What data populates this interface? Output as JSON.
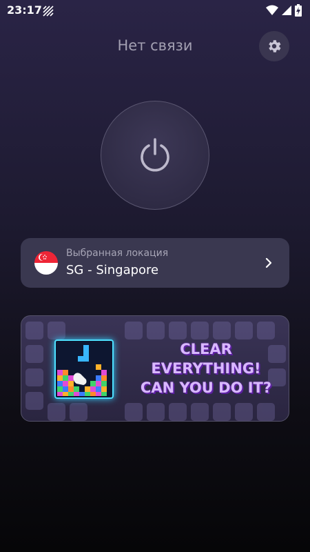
{
  "status_bar": {
    "time": "23:17",
    "left_icon": "no-data-icon",
    "right_icons": [
      "wifi-icon",
      "signal-icon",
      "battery-charging-icon"
    ]
  },
  "header": {
    "title": "Нет связи",
    "settings_icon": "gear-icon"
  },
  "connect": {
    "icon": "power-icon"
  },
  "location": {
    "label": "Выбранная локация",
    "value": "SG - Singapore",
    "flag_icon": "singapore-flag-icon",
    "chevron_icon": "chevron-right-icon"
  },
  "ad": {
    "line1": "CLEAR",
    "line2": "EVERYTHING!",
    "line3": "CAN YOU DO IT?"
  },
  "colors": {
    "background_top": "#2a2446",
    "background_bottom": "#060608",
    "card": "#3a3850",
    "ad_text": "#d9b8ff"
  }
}
